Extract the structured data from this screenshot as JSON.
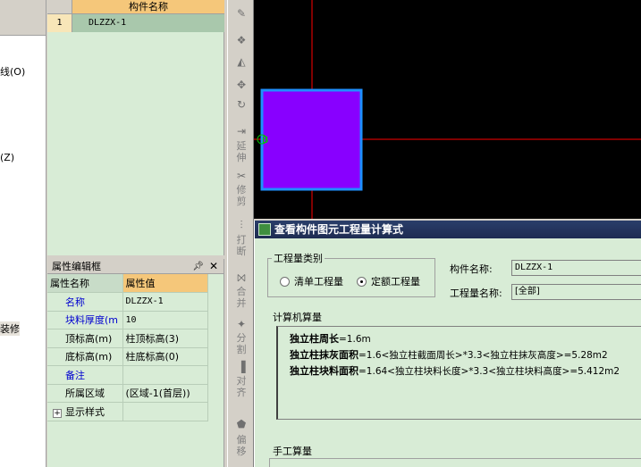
{
  "left_panel": {
    "items": [
      "线(O)",
      "(Z)",
      "装修"
    ]
  },
  "component_list": {
    "header": "构件名称",
    "rows": [
      {
        "index": "1",
        "name": "DLZZX-1"
      }
    ]
  },
  "properties": {
    "title": "属性编辑框",
    "pin_icon": "pin-icon",
    "close_label": "✕",
    "col_name": "属性名称",
    "col_value": "属性值",
    "rows": [
      {
        "name": "名称",
        "value": "DLZZX-1",
        "color": "#0000d0"
      },
      {
        "name": "块料厚度(m",
        "value": "10",
        "color": "#0000d0"
      },
      {
        "name": "顶标高(m)",
        "value": "柱顶标高(3)",
        "color": "#000000"
      },
      {
        "name": "底标高(m)",
        "value": "柱底标高(0)",
        "color": "#000000"
      },
      {
        "name": "备注",
        "value": "",
        "color": "#0000d0"
      },
      {
        "name": "所属区域",
        "value": "(区域-1(首层))",
        "color": "#000000"
      },
      {
        "name": "显示样式",
        "value": "",
        "color": "#000000",
        "expand": "+"
      }
    ]
  },
  "toolbar": {
    "tools": [
      "延伸",
      "修剪",
      "打断",
      "合并",
      "分割",
      "对齐",
      "偏移"
    ]
  },
  "canvas": {
    "marker": "B",
    "colors": {
      "background": "#000000",
      "fill": "#8800ff",
      "border": "#1e90ff",
      "axis": "#ff0000"
    }
  },
  "dialog": {
    "title": "查看构件图元工程量计算式",
    "quantity_type": {
      "legend": "工程量类别",
      "options": [
        {
          "label": "清单工程量",
          "selected": false
        },
        {
          "label": "定额工程量",
          "selected": true
        }
      ]
    },
    "component_name_label": "构件名称:",
    "component_name_value": "DLZZX-1",
    "quantity_name_label": "工程量名称:",
    "quantity_name_value": "[全部]",
    "computer_calc": {
      "legend": "计算机算量",
      "lines": [
        {
          "label": "独立柱周长",
          "formula": "=1.6m"
        },
        {
          "label": "独立柱抹灰面积",
          "formula": "=1.6<独立柱截面周长>*3.3<独立柱抹灰高度>=5.28m2"
        },
        {
          "label": "独立柱块料面积",
          "formula": "=1.64<独立柱块料长度>*3.3<独立柱块料高度>=5.412m2"
        }
      ]
    },
    "manual_calc": {
      "legend": "手工算量"
    }
  }
}
